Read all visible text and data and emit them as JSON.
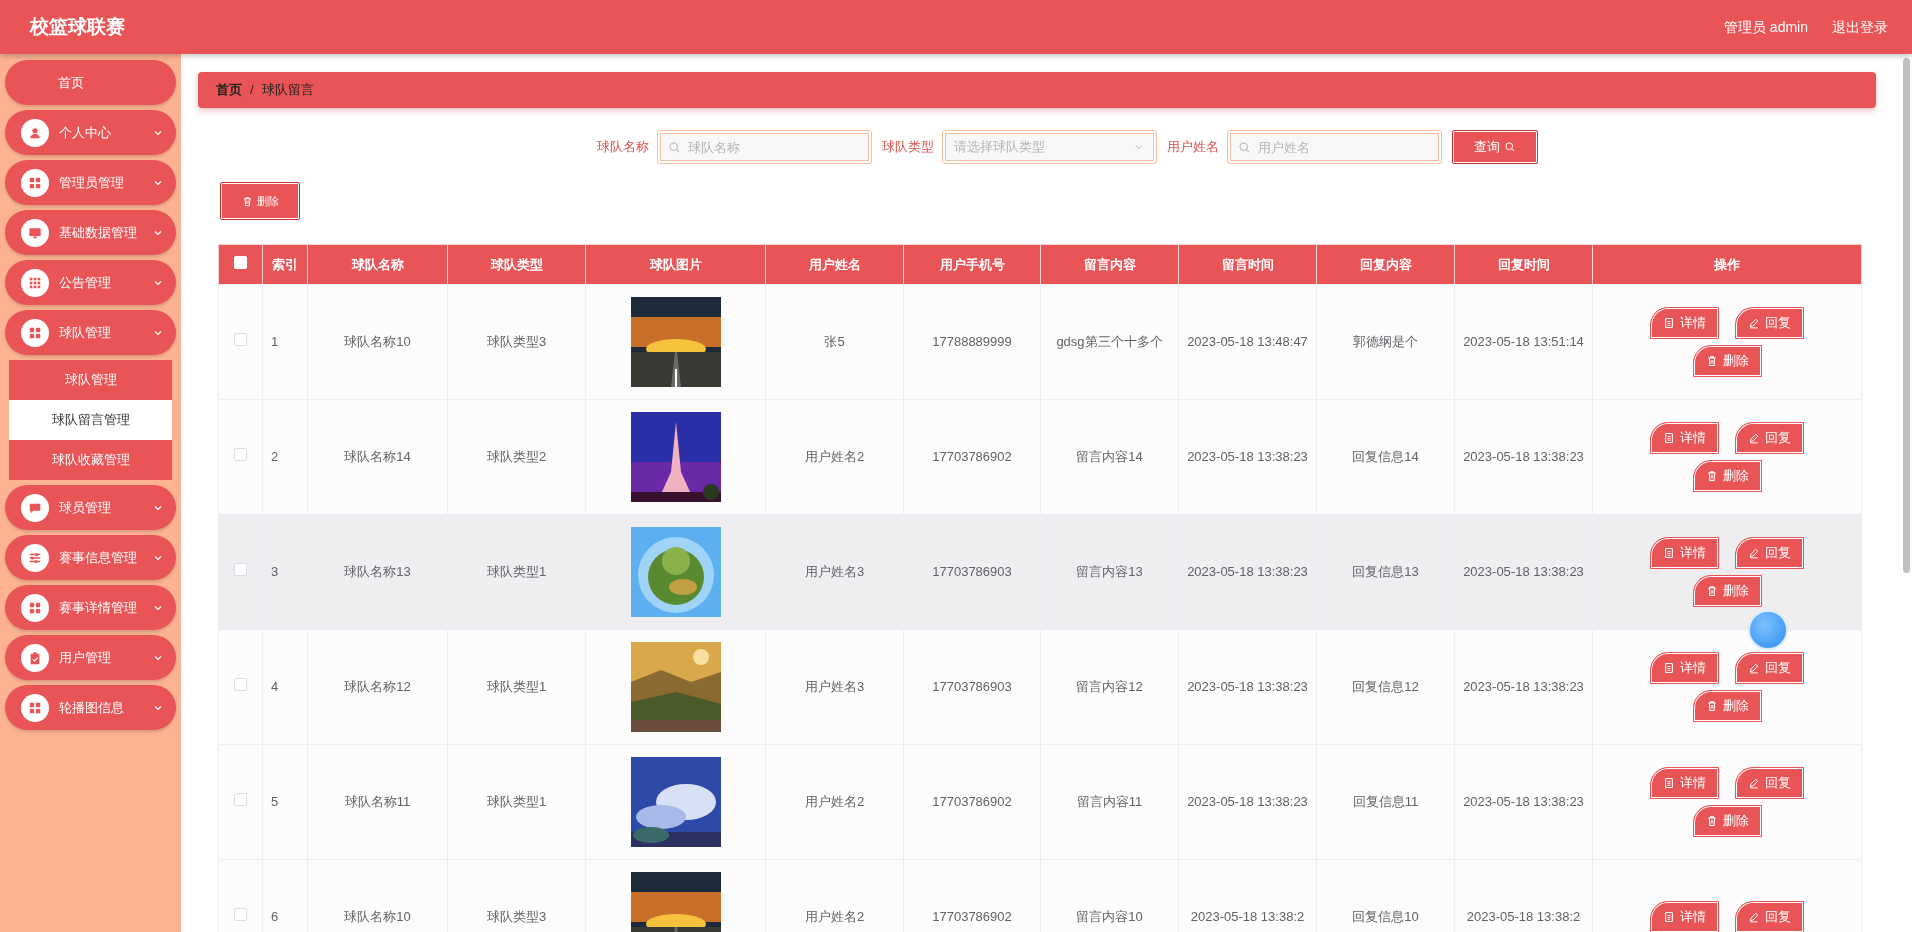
{
  "header": {
    "title": "校篮球联赛",
    "user": "管理员 admin",
    "logout": "退出登录"
  },
  "sidebar": {
    "items": [
      {
        "kind": "link",
        "label": "首页"
      },
      {
        "kind": "menu",
        "label": "个人中心"
      },
      {
        "kind": "menu",
        "label": "管理员管理"
      },
      {
        "kind": "menu",
        "label": "基础数据管理"
      },
      {
        "kind": "menu",
        "label": "公告管理"
      },
      {
        "kind": "menu",
        "label": "球队管理",
        "children": [
          {
            "label": "球队管理",
            "selected": false
          },
          {
            "label": "球队留言管理",
            "selected": true
          },
          {
            "label": "球队收藏管理",
            "selected": false
          }
        ]
      },
      {
        "kind": "menu",
        "label": "球员管理"
      },
      {
        "kind": "menu",
        "label": "赛事信息管理"
      },
      {
        "kind": "menu",
        "label": "赛事详情管理"
      },
      {
        "kind": "menu",
        "label": "用户管理"
      },
      {
        "kind": "menu",
        "label": "轮播图信息"
      }
    ]
  },
  "breadcrumb": [
    "首页",
    "/",
    "球队留言"
  ],
  "search": {
    "fields": [
      {
        "kind": "text",
        "label": "球队名称",
        "placeholder": "球队名称"
      },
      {
        "kind": "select",
        "label": "球队类型",
        "placeholder": "请选择球队类型"
      },
      {
        "kind": "text",
        "label": "用户姓名",
        "placeholder": "用户姓名"
      }
    ],
    "button": "查询"
  },
  "toolbar": {
    "delete": "删除"
  },
  "table": {
    "select_all_checked": false,
    "columns": [
      "索引",
      "球队名称",
      "球队类型",
      "球队图片",
      "用户姓名",
      "用户手机号",
      "留言内容",
      "留言时间",
      "回复内容",
      "回复时间",
      "操作"
    ],
    "rows": [
      {
        "checked": false,
        "highlighted": false,
        "cells": [
          "1",
          "球队名称10",
          "球队类型3",
          "",
          "张5",
          "17788889999",
          "gdsg第三个十多个",
          "2023-05-18 13:48:47",
          "郭德纲是个",
          "2023-05-18 13:51:14"
        ],
        "actions": [
          "详情",
          "回复",
          "删除"
        ]
      },
      {
        "checked": false,
        "highlighted": false,
        "cells": [
          "2",
          "球队名称14",
          "球队类型2",
          "",
          "用户姓名2",
          "17703786902",
          "留言内容14",
          "2023-05-18 13:38:23",
          "回复信息14",
          "2023-05-18 13:38:23"
        ],
        "actions": [
          "详情",
          "回复",
          "删除"
        ]
      },
      {
        "checked": false,
        "highlighted": true,
        "cells": [
          "3",
          "球队名称13",
          "球队类型1",
          "",
          "用户姓名3",
          "17703786903",
          "留言内容13",
          "2023-05-18 13:38:23",
          "回复信息13",
          "2023-05-18 13:38:23"
        ],
        "actions": [
          "详情",
          "回复",
          "删除"
        ]
      },
      {
        "checked": false,
        "highlighted": false,
        "cells": [
          "4",
          "球队名称12",
          "球队类型1",
          "",
          "用户姓名3",
          "17703786903",
          "留言内容12",
          "2023-05-18 13:38:23",
          "回复信息12",
          "2023-05-18 13:38:23"
        ],
        "actions": [
          "详情",
          "回复",
          "删除"
        ]
      },
      {
        "checked": false,
        "highlighted": false,
        "cells": [
          "5",
          "球队名称11",
          "球队类型1",
          "",
          "用户姓名2",
          "17703786902",
          "留言内容11",
          "2023-05-18 13:38:23",
          "回复信息11",
          "2023-05-18 13:38:23"
        ],
        "actions": [
          "详情",
          "回复",
          "删除"
        ]
      },
      {
        "checked": false,
        "highlighted": false,
        "cells": [
          "6",
          "球队名称10",
          "球队类型3",
          "",
          "用户姓名2",
          "17703786902",
          "留言内容10",
          "2023-05-18 13:38:2",
          "回复信息10",
          "2023-05-18 13:38:2"
        ],
        "actions": [
          "详情",
          "回复"
        ]
      }
    ]
  }
}
